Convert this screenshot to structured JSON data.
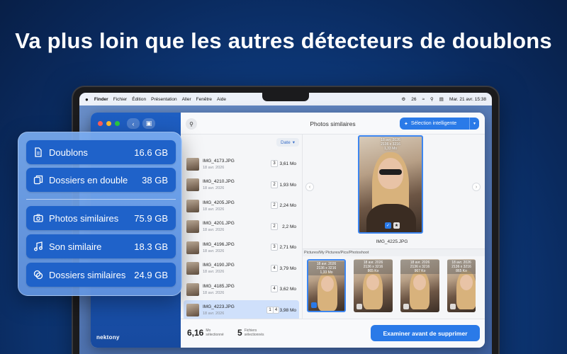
{
  "headline": "Va plus loin que les autres détecteurs de doublons",
  "menubar": {
    "apple": "",
    "items": [
      "Finder",
      "Fichier",
      "Édition",
      "Présentation",
      "Aller",
      "Fenêtre",
      "Aide"
    ],
    "battery": "26",
    "datetime": "Mar. 21 avr.  15:38"
  },
  "app": {
    "brand": "nektony",
    "topbar": {
      "title": "Photos similaires",
      "smart_selection": "Sélection intelligente"
    },
    "list": {
      "sort_label": "Date",
      "rows": [
        {
          "name": "IMG_4173.JPG",
          "date": "18 avr. 2026",
          "count": "3",
          "size": "3,61 Mo"
        },
        {
          "name": "IMG_4210.JPG",
          "date": "18 avr. 2026",
          "count": "2",
          "size": "1,93 Mo"
        },
        {
          "name": "IMG_4205.JPG",
          "date": "18 avr. 2026",
          "count": "2",
          "size": "2,24 Mo"
        },
        {
          "name": "IMG_4201.JPG",
          "date": "18 avr. 2026",
          "count": "2",
          "size": "2,2 Mo"
        },
        {
          "name": "IMG_4196.JPG",
          "date": "18 avr. 2026",
          "count": "3",
          "size": "2,71 Mo"
        },
        {
          "name": "IMG_4190.JPG",
          "date": "18 avr. 2026",
          "count": "4",
          "size": "3,79 Mo"
        },
        {
          "name": "IMG_4185.JPG",
          "date": "18 avr. 2026",
          "count": "4",
          "size": "3,62 Mo"
        },
        {
          "name": "IMG_4223.JPG",
          "date": "18 avr. 2026",
          "count": "1",
          "count2": "4",
          "size": "3,98 Mo"
        }
      ]
    },
    "preview": {
      "photo_label": [
        "18 avr. 2026",
        "2136 x 3216",
        "1,33 Mo"
      ],
      "filename": "IMG_4225.JPG",
      "path": "Pictures/My Pictures/Pics/Photoshoot",
      "thumbs": [
        {
          "l1": "18 avr. 2026",
          "l2": "2136 x 3216",
          "l3": "1,33 Mo"
        },
        {
          "l1": "18 avr. 2026",
          "l2": "2136 x 3216",
          "l3": "865 Ko"
        },
        {
          "l1": "18 avr. 2026",
          "l2": "2136 x 3216",
          "l3": "967 Ko"
        },
        {
          "l1": "18 avr. 2026",
          "l2": "2136 x 3216",
          "l3": "865 Ko"
        }
      ]
    },
    "bottom": {
      "size_value": "6,16",
      "size_label1": "Mo",
      "size_label2": "sélectionné",
      "files_value": "5",
      "files_label1": "Fichiers",
      "files_label2": "sélectionnés",
      "examine": "Examiner avant de supprimer"
    }
  },
  "card": {
    "items": [
      {
        "label": "Doublons",
        "value": "16.6 GB",
        "icon": "document-icon"
      },
      {
        "label": "Dossiers en double",
        "value": "38 GB",
        "icon": "copy-icon"
      },
      {
        "label": "Photos similaires",
        "value": "75.9 GB",
        "icon": "camera-icon"
      },
      {
        "label": "Son similaire",
        "value": "18.3 GB",
        "icon": "music-note-icon"
      },
      {
        "label": "Dossiers similaires",
        "value": "24.9 GB",
        "icon": "overlap-circles-icon"
      }
    ]
  }
}
